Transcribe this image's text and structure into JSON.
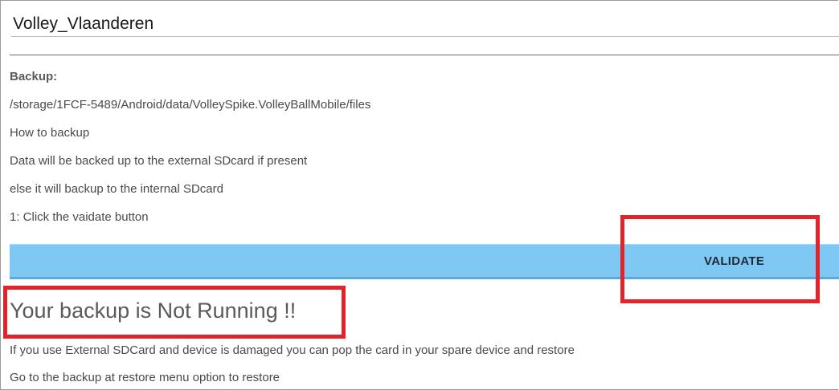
{
  "app_name": "Volley_Vlaanderen",
  "backup": {
    "label": "Backup:",
    "path": "/storage/1FCF-5489/Android/data/VolleySpike.VolleyBallMobile/files",
    "how_to": "How to backup",
    "line_external": "Data will be backed up to the external SDcard if present",
    "line_internal": "else it will backup to the internal SDcard",
    "step_1": "1: Click the vaidate button"
  },
  "validate_button": {
    "label": "VALIDATE",
    "color": "#80c8f4"
  },
  "status": {
    "text": "Your backup is Not Running !!"
  },
  "info": {
    "line_1": "If you use External SDCard and device is damaged you can pop the card in your spare device and restore",
    "line_2": "Go to the backup at restore menu option to restore"
  },
  "annotation_color": "#e0242c"
}
